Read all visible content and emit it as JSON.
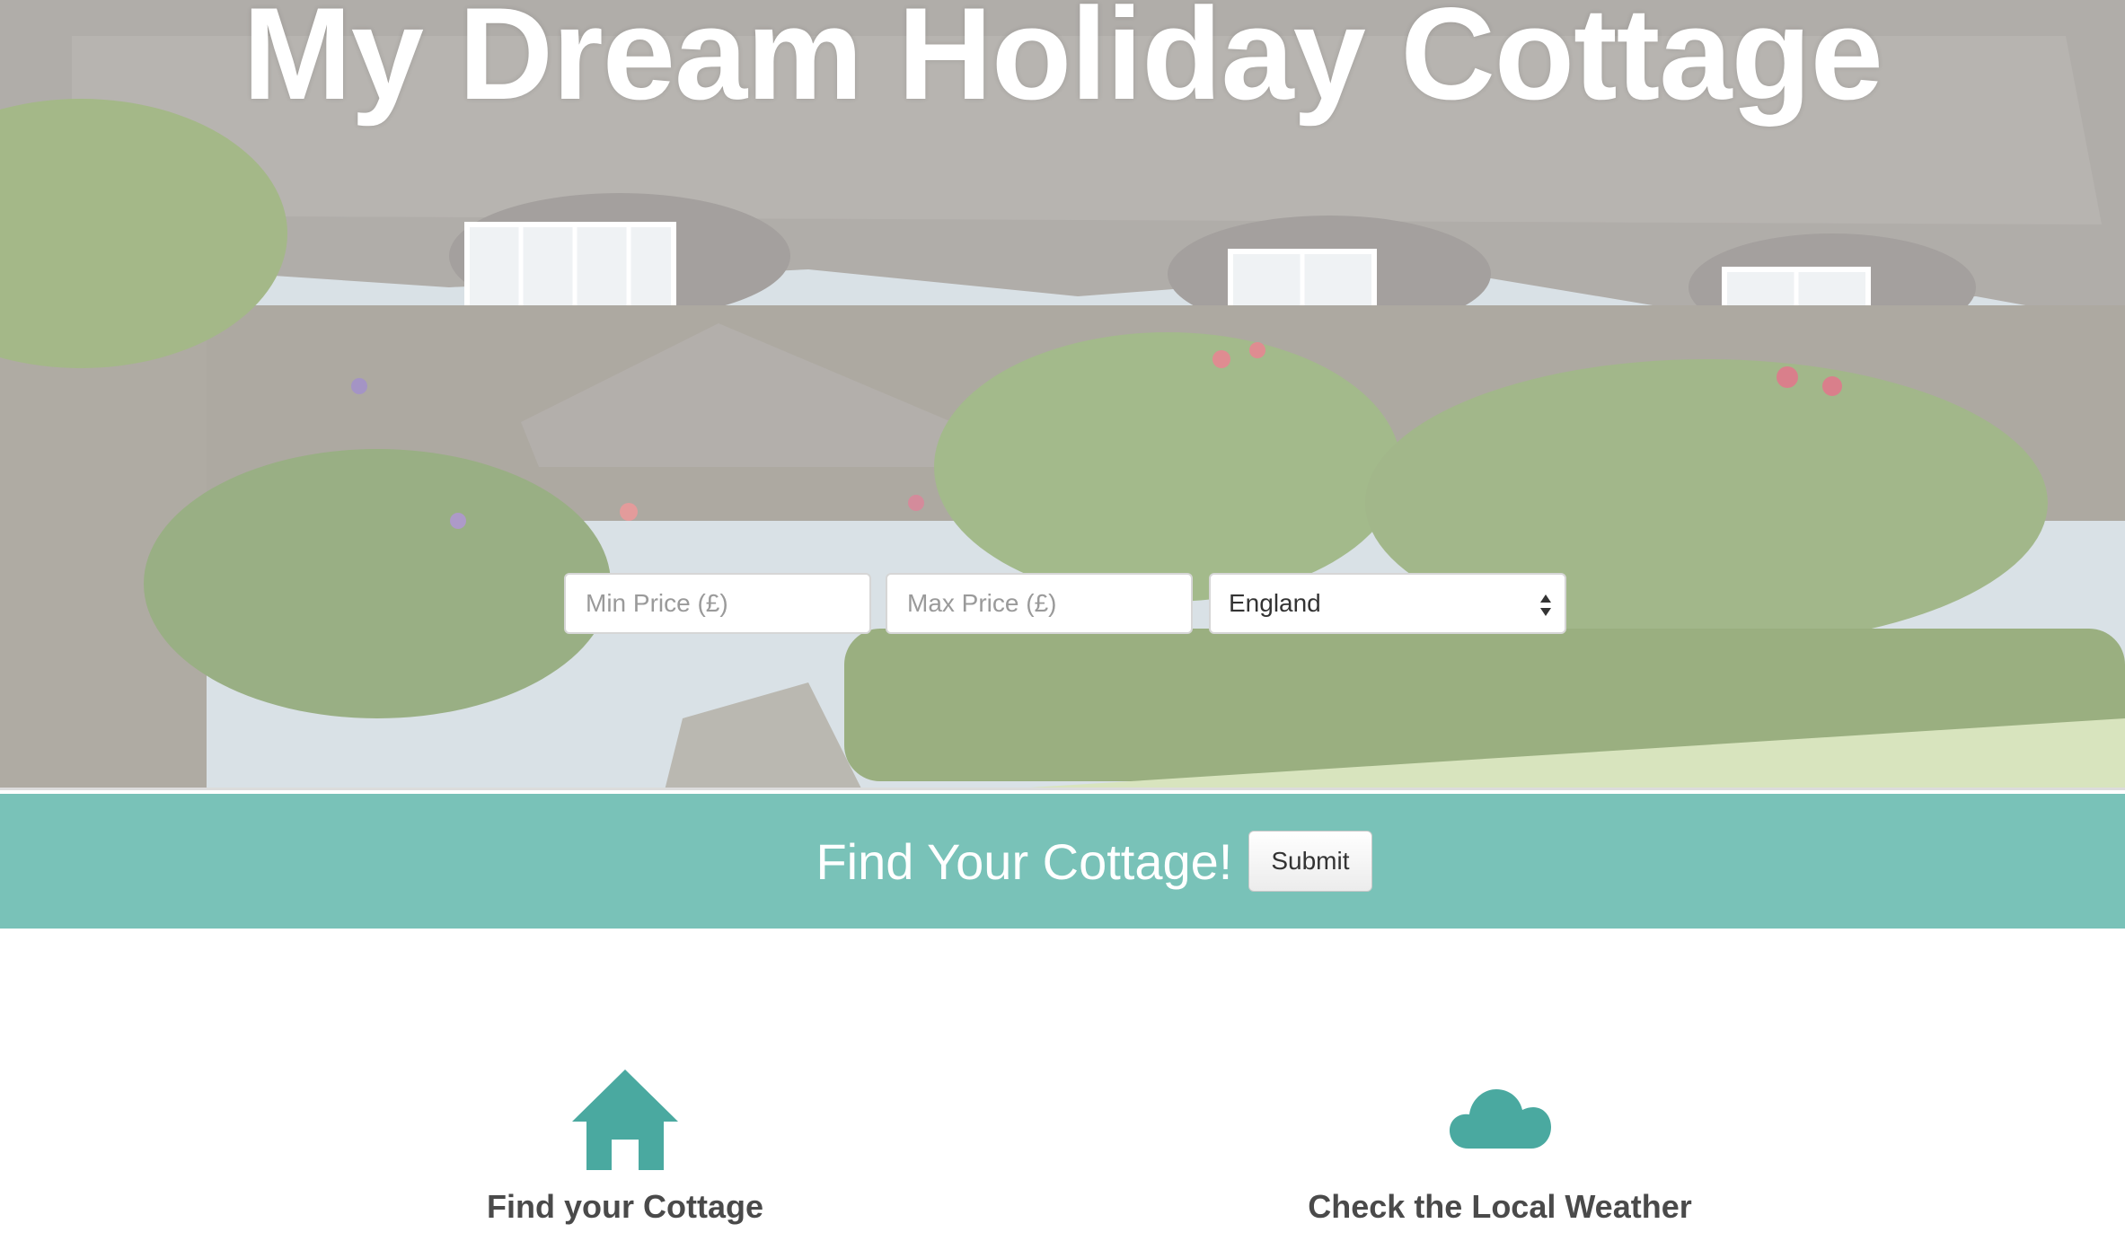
{
  "page": {
    "title": "My Dream Holiday Cottage"
  },
  "search": {
    "min_price_placeholder": "Min Price (£)",
    "max_price_placeholder": "Max Price (£)",
    "country_selected": "England"
  },
  "cta": {
    "text": "Find Your Cottage!",
    "submit_label": "Submit"
  },
  "features": [
    {
      "label": "Find your Cottage",
      "icon": "house-icon"
    },
    {
      "label": "Check the Local Weather",
      "icon": "cloud-icon"
    }
  ],
  "colors": {
    "accent": "#79c2b8",
    "icon": "#4aa9a0",
    "heading_text": "#4a4a4a"
  }
}
